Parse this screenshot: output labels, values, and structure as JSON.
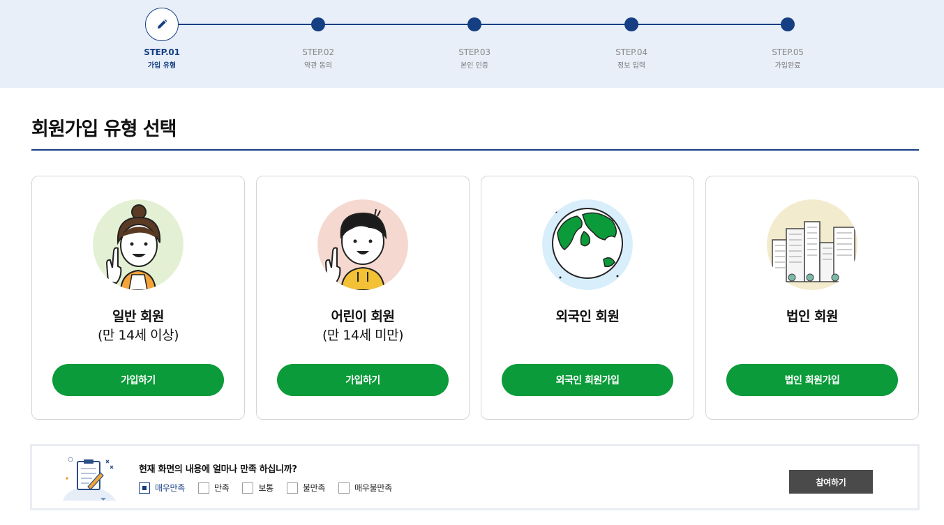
{
  "stepper": {
    "steps": [
      {
        "num": "STEP.01",
        "label": "가입 유형",
        "current": true
      },
      {
        "num": "STEP.02",
        "label": "약관 동의",
        "current": false
      },
      {
        "num": "STEP.03",
        "label": "본인 인증",
        "current": false
      },
      {
        "num": "STEP.04",
        "label": "정보 입력",
        "current": false
      },
      {
        "num": "STEP.05",
        "label": "가입완료",
        "current": false
      }
    ],
    "active_icon": "pencil-icon"
  },
  "page": {
    "title": "회원가입 유형 선택"
  },
  "cards": [
    {
      "name": "일반 회원",
      "sub": "(만 14세 이상)",
      "button": "가입하기",
      "icon": "woman-pointing-illustration"
    },
    {
      "name": "어린이 회원",
      "sub": "(만 14세 미만)",
      "button": "가입하기",
      "icon": "child-pointing-illustration"
    },
    {
      "name": "외국인 회원",
      "sub": "",
      "button": "외국인 회원가입",
      "icon": "globe-illustration"
    },
    {
      "name": "법인 회원",
      "sub": "",
      "button": "법인 회원가입",
      "icon": "city-buildings-illustration"
    }
  ],
  "survey": {
    "question": "현재 화면의 내용에 얼마나 만족 하십니까?",
    "options": [
      {
        "label": "매우만족",
        "checked": true
      },
      {
        "label": "만족",
        "checked": false
      },
      {
        "label": "보통",
        "checked": false
      },
      {
        "label": "불만족",
        "checked": false
      },
      {
        "label": "매우불만족",
        "checked": false
      }
    ],
    "submit_label": "참여하기",
    "icon": "clipboard-survey-icon"
  },
  "colors": {
    "primary_navy": "#153e83",
    "stepper_bg": "#e8eff8",
    "button_green": "#0b9b3a",
    "submit_gray": "#4a4a4a"
  }
}
